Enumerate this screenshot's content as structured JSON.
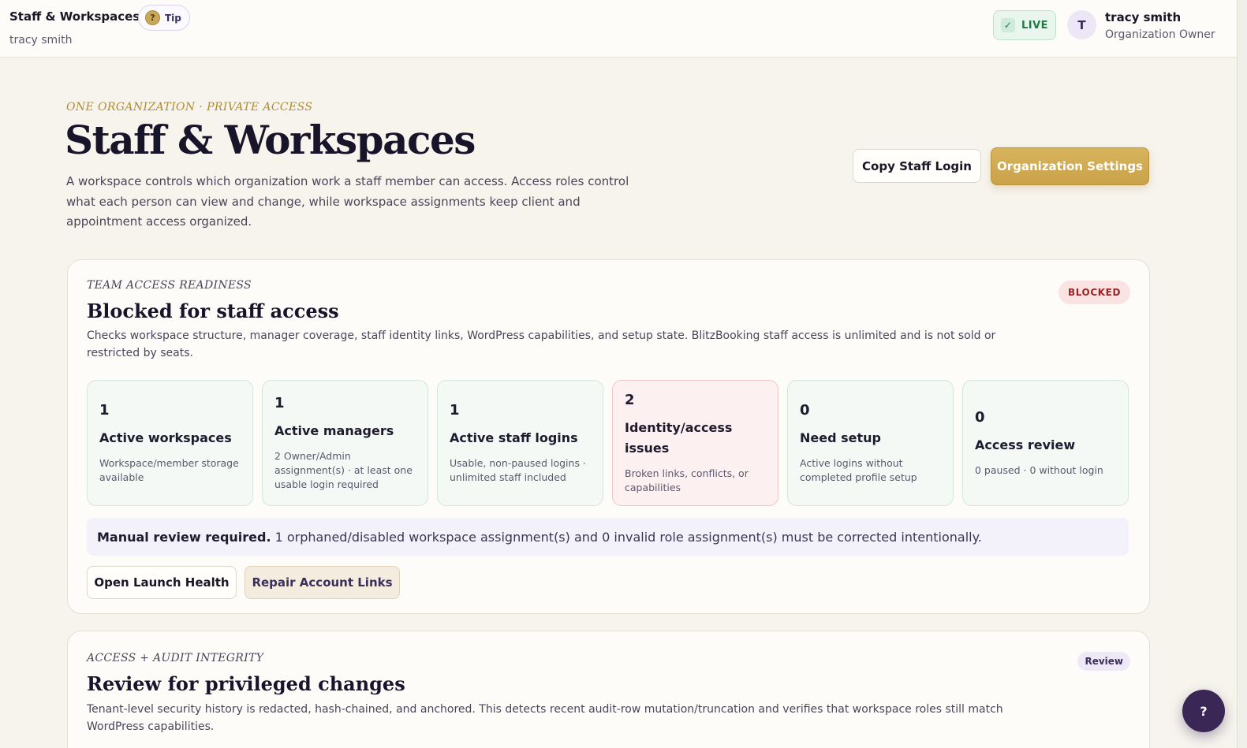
{
  "topbar": {
    "app_title": "Staff & Workspaces",
    "tip_label": "Tip",
    "tip_icon": "?",
    "user_subtitle": "tracy smith",
    "live_label": "LIVE",
    "live_icon": "✓",
    "avatar_initial": "T",
    "user_name": "tracy smith",
    "user_role": "Organization Owner"
  },
  "hero": {
    "eyebrow": "ONE ORGANIZATION · PRIVATE ACCESS",
    "title": "Staff & Workspaces",
    "description": "A workspace controls which organization work a staff member can access. Access roles control what each person can view and change, while workspace assignments keep client and appointment access organized.",
    "copy_login_label": "Copy Staff Login",
    "org_settings_label": "Organization Settings"
  },
  "readiness": {
    "kicker": "TEAM ACCESS READINESS",
    "heading": "Blocked for staff access",
    "badge": "BLOCKED",
    "description": "Checks workspace structure, manager coverage, staff identity links, WordPress capabilities, and setup state. BlitzBooking staff access is unlimited and is not sold or restricted by seats.",
    "stats": [
      {
        "value": "1",
        "label": "Active workspaces",
        "note": "Workspace/member storage available",
        "status": "ok"
      },
      {
        "value": "1",
        "label": "Active managers",
        "note": "2 Owner/Admin assignment(s) · at least one usable login required",
        "status": "ok"
      },
      {
        "value": "1",
        "label": "Active staff logins",
        "note": "Usable, non-paused logins · unlimited staff included",
        "status": "ok"
      },
      {
        "value": "2",
        "label": "Identity/access issues",
        "note": "Broken links, conflicts, or capabilities",
        "status": "alert"
      },
      {
        "value": "0",
        "label": "Need setup",
        "note": "Active logins without completed profile setup",
        "status": "ok"
      },
      {
        "value": "0",
        "label": "Access review",
        "note": "0 paused · 0 without login",
        "status": "ok"
      }
    ],
    "manual_strong": "Manual review required.",
    "manual_text": "1 orphaned/disabled workspace assignment(s) and 0 invalid role assignment(s) must be corrected intentionally.",
    "launch_health_label": "Open Launch Health",
    "repair_links_label": "Repair Account Links"
  },
  "audit": {
    "kicker": "ACCESS + AUDIT INTEGRITY",
    "heading": "Review for privileged changes",
    "badge": "Review",
    "description": "Tenant-level security history is redacted, hash-chained, and anchored. This detects recent audit-row mutation/truncation and verifies that workspace roles still match WordPress capabilities."
  },
  "help_fab_label": "?",
  "colors": {
    "accent_gold": "#c9a24a",
    "live_green": "#1f7a47",
    "blocked_red": "#9a2424",
    "fab_purple": "#3a2755"
  }
}
